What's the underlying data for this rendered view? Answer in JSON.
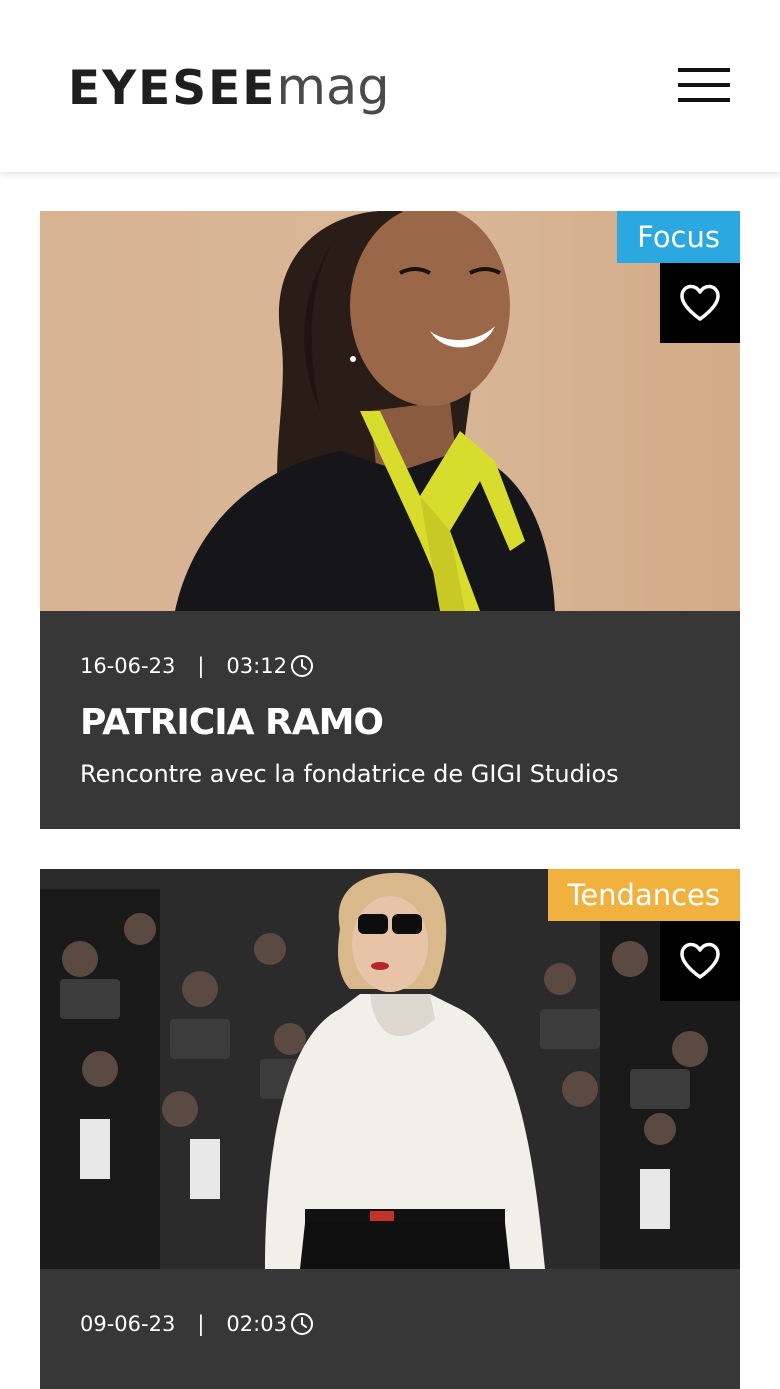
{
  "header": {
    "logo_strong": "EYESEE",
    "logo_light": "mag",
    "menu_icon": "hamburger-menu-icon"
  },
  "articles": [
    {
      "category": "Focus",
      "category_color": "#2ba8e0",
      "date": "16-06-23",
      "separator": "|",
      "read_time": "03:12",
      "title": "PATRICIA RAMO",
      "subtitle": "Rencontre avec la fondatrice de GIGI Studios",
      "favorite_icon": "heart-icon",
      "time_icon": "clock-icon"
    },
    {
      "category": "Tendances",
      "category_color": "#f0b13f",
      "date": "09-06-23",
      "separator": "|",
      "read_time": "02:03",
      "favorite_icon": "heart-icon",
      "time_icon": "clock-icon"
    }
  ],
  "colors": {
    "card_body": "#373737",
    "favorite_bg": "#000000"
  }
}
